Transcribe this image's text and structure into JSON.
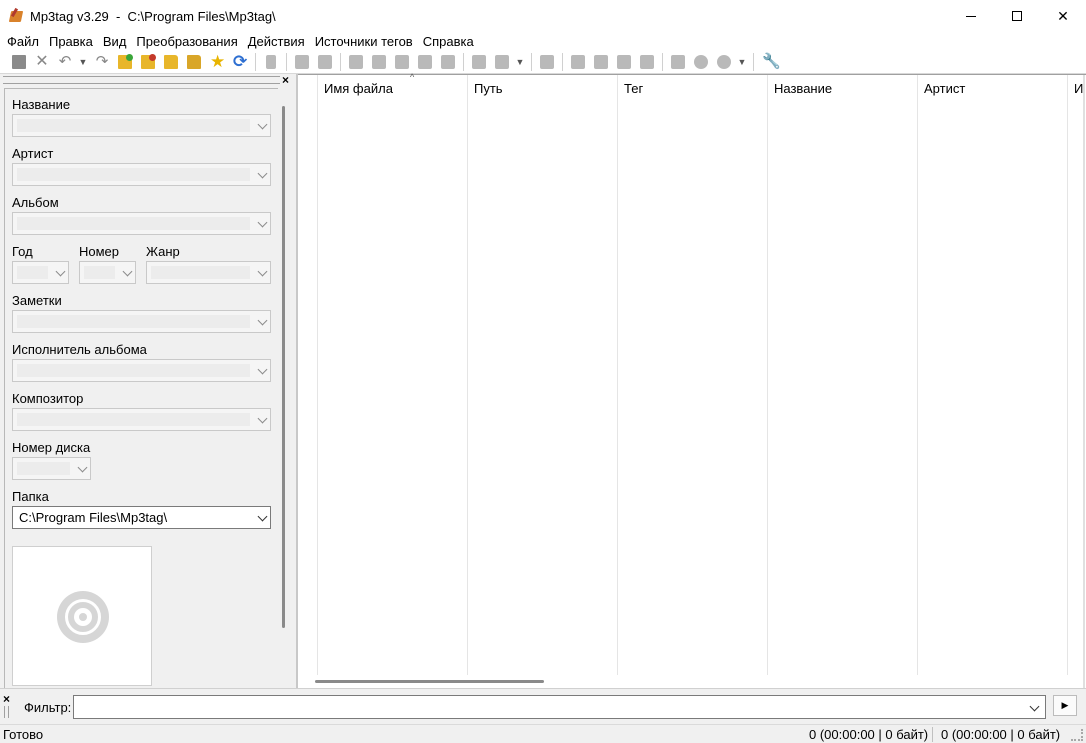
{
  "window": {
    "title": "Mp3tag v3.29  -  C:\\Program Files\\Mp3tag\\",
    "minimize": "—",
    "maximize": "☐",
    "close": "✕"
  },
  "menu": [
    "Файл",
    "Правка",
    "Вид",
    "Преобразования",
    "Действия",
    "Источники тегов",
    "Справка"
  ],
  "toolbar": {
    "icons": [
      "save-icon",
      "remove-tag-icon",
      "undo-icon",
      "redo-icon",
      "change-directory-icon",
      "add-directory-icon",
      "open-folder-icon",
      "folder-playlist-icon",
      "favorites-star-icon",
      "refresh-icon",
      "select-all-icon",
      "print-icon",
      "export-icon",
      "tag-filename-icon",
      "filename-tag-icon",
      "text-tag-icon",
      "tag-tag-icon",
      "autonumber-icon",
      "actions-icon",
      "case-convert-icon",
      "extended-tags-icon",
      "playlist-icon",
      "tag-sources-icon",
      "discogs-icon",
      "web-sources-icon",
      "options-wrench-icon"
    ]
  },
  "tag_panel": {
    "close": "×",
    "fields": {
      "title": "Название",
      "artist": "Артист",
      "album": "Альбом",
      "year": "Год",
      "track": "Номер",
      "genre": "Жанр",
      "comment": "Заметки",
      "album_artist": "Исполнитель альбома",
      "composer": "Композитор",
      "disc": "Номер диска",
      "folder": "Папка"
    },
    "folder_value": "C:\\Program Files\\Mp3tag\\"
  },
  "file_list": {
    "columns": [
      "Имя файла",
      "Путь",
      "Тег",
      "Название",
      "Артист",
      "И"
    ],
    "sort_indicator": "^",
    "rows": []
  },
  "filter": {
    "close": "×",
    "label": "Фильтр:",
    "value": "",
    "go": "▶"
  },
  "status": {
    "ready": "Готово",
    "selected": "0 (00:00:00 | 0 байт)",
    "total": "0 (00:00:00 | 0 байт)"
  }
}
